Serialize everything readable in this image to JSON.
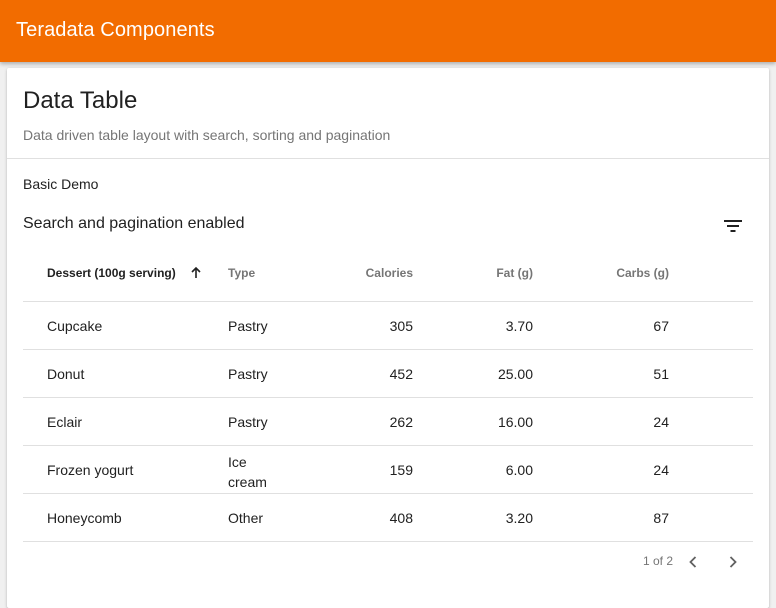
{
  "app": {
    "title": "Teradata Components",
    "accent": "#f26c00"
  },
  "card": {
    "title": "Data Table",
    "subtitle": "Data driven table layout with search, sorting and pagination"
  },
  "demo": {
    "label": "Basic Demo",
    "table_title": "Search and pagination enabled",
    "filter_icon": "filter-list-icon"
  },
  "table": {
    "columns": [
      {
        "label": "Dessert (100g serving)",
        "sorted": "ascending"
      },
      {
        "label": "Type"
      },
      {
        "label": "Calories"
      },
      {
        "label": "Fat (g)"
      },
      {
        "label": "Carbs (g)"
      }
    ],
    "rows": [
      {
        "name": "Cupcake",
        "type": "Pastry",
        "calories": "305",
        "fat": "3.70",
        "carbs": "67"
      },
      {
        "name": "Donut",
        "type": "Pastry",
        "calories": "452",
        "fat": "25.00",
        "carbs": "51"
      },
      {
        "name": "Eclair",
        "type": "Pastry",
        "calories": "262",
        "fat": "16.00",
        "carbs": "24"
      },
      {
        "name": "Frozen yogurt",
        "type": "Ice cream",
        "calories": "159",
        "fat": "6.00",
        "carbs": "24"
      },
      {
        "name": "Honeycomb",
        "type": "Other",
        "calories": "408",
        "fat": "3.20",
        "carbs": "87"
      }
    ]
  },
  "pagination": {
    "text": "1 of 2",
    "prev_icon": "chevron-left-icon",
    "next_icon": "chevron-right-icon"
  }
}
